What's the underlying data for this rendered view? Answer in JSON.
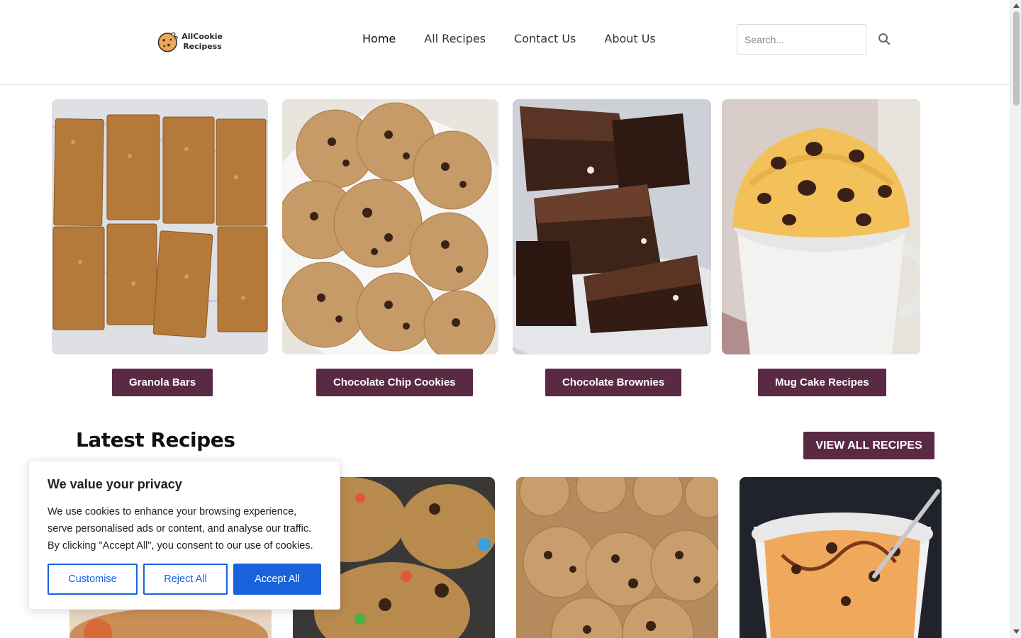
{
  "header": {
    "logo_line1": "AllCookie",
    "logo_line2": "Recipess",
    "nav": [
      "Home",
      "All Recipes",
      "Contact Us",
      "About Us"
    ],
    "search_placeholder": "Search..."
  },
  "categories": [
    {
      "label": "Granola Bars",
      "image": "granola-bars-image"
    },
    {
      "label": "Chocolate Chip Cookies",
      "image": "chocolate-chip-cookies-image"
    },
    {
      "label": "Chocolate Brownies",
      "image": "chocolate-brownies-image"
    },
    {
      "label": "Mug Cake Recipes",
      "image": "mug-cake-image"
    }
  ],
  "latest": {
    "title": "Latest Recipes",
    "view_all": "VIEW ALL RECIPES"
  },
  "cookie_banner": {
    "title": "We value your privacy",
    "text": "We use cookies to enhance your browsing experience, serve personalised ads or content, and analyse our traffic. By clicking \"Accept All\", you consent to our use of cookies.",
    "customise": "Customise",
    "reject": "Reject All",
    "accept": "Accept All"
  },
  "colors": {
    "accent": "#5a2a44",
    "cookie_blue": "#1863dc"
  }
}
